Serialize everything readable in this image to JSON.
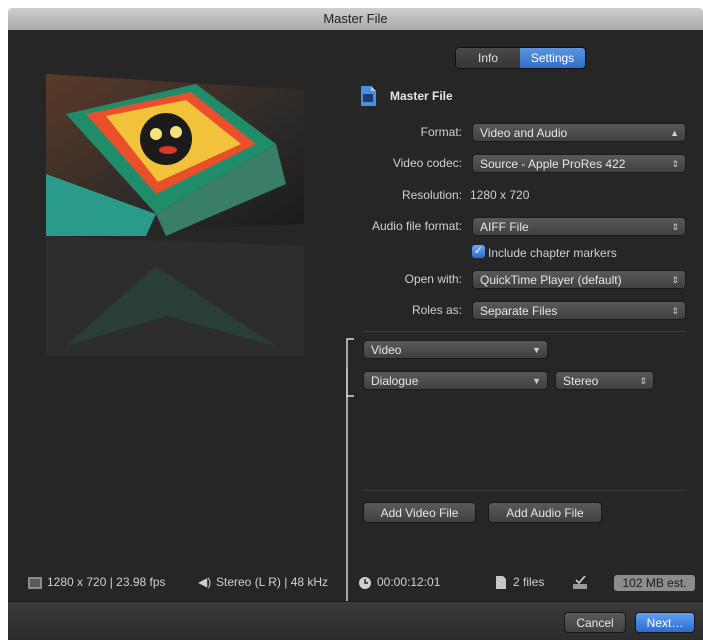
{
  "window": {
    "title": "Master File"
  },
  "tabs": [
    {
      "label": "Info"
    },
    {
      "label": "Settings"
    }
  ],
  "settings": {
    "header": "Master File",
    "format": {
      "label": "Format:",
      "value": "Video and Audio"
    },
    "video_codec": {
      "label": "Video codec:",
      "value": "Source - Apple ProRes 422"
    },
    "resolution": {
      "label": "Resolution:",
      "value": "1280 x 720"
    },
    "audio_format": {
      "label": "Audio file format:",
      "value": "AIFF File"
    },
    "chapter_markers": {
      "label": "Include chapter markers",
      "checked": true
    },
    "open_with": {
      "label": "Open with:",
      "value": "QuickTime Player (default)"
    },
    "roles_as": {
      "label": "Roles as:",
      "value": "Separate Files"
    }
  },
  "roles": {
    "video_role": "Video",
    "audio_role": "Dialogue",
    "audio_channels": "Stereo",
    "add_video_button": "Add Video File",
    "add_audio_button": "Add Audio File"
  },
  "status": {
    "video": "1280 x 720 | 23.98 fps",
    "audio": "Stereo (L R) | 48 kHz",
    "duration": "00:00:12:01",
    "files": "2 files",
    "size": "102 MB est."
  },
  "footer": {
    "cancel": "Cancel",
    "next": "Next…"
  },
  "colors": {
    "accent": "#2f6fc8",
    "window_bg": "#262626"
  }
}
